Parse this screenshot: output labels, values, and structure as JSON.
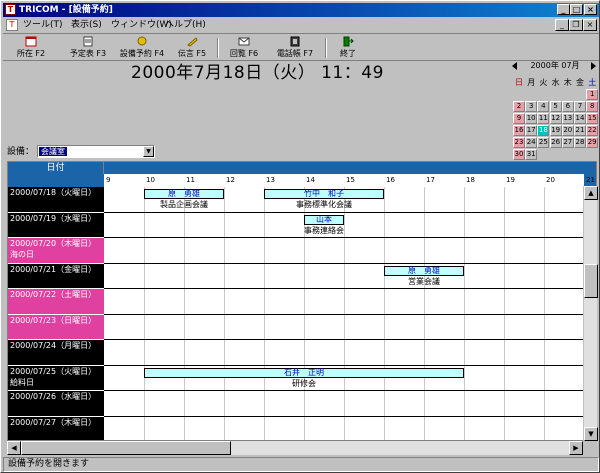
{
  "window": {
    "title": "TRICOM - [設備予約]"
  },
  "menu": [
    {
      "label": "ツール(T)"
    },
    {
      "label": "表示(S)"
    },
    {
      "label": "ウィンドウ(W)"
    },
    {
      "label": "ヘルプ(H)"
    }
  ],
  "toolbar": [
    {
      "label": "所在 F2",
      "icon": "calendar-icon",
      "color": "#c00000"
    },
    {
      "label": "予定表 F3",
      "icon": "schedule-icon",
      "color": "#404040"
    },
    {
      "label": "設備予約 F4",
      "icon": "equipment-icon",
      "color": "#c0a000"
    },
    {
      "label": "伝言 F5",
      "icon": "message-icon",
      "color": "#c0a000"
    },
    {
      "label": "回覧 F6",
      "icon": "circular-icon",
      "color": "#404040"
    },
    {
      "label": "電話帳 F7",
      "icon": "phonebook-icon",
      "color": "#404040"
    },
    {
      "label": "終了",
      "icon": "exit-icon",
      "color": "#008000"
    }
  ],
  "clock": {
    "text": "2000年7月18日（火） 11：49"
  },
  "equipment": {
    "label": "設備：",
    "value": "会議室"
  },
  "calendar": {
    "month_label": "2000年 07月",
    "weekdays": [
      "日",
      "月",
      "火",
      "水",
      "木",
      "金",
      "土"
    ],
    "weekday_colors": [
      "#c00000",
      "#000000",
      "#000000",
      "#000000",
      "#000000",
      "#000000",
      "#0000c0"
    ],
    "weeks": [
      [
        "",
        "",
        "",
        "",
        "",
        "",
        "1"
      ],
      [
        "2",
        "3",
        "4",
        "5",
        "6",
        "7",
        "8"
      ],
      [
        "9",
        "10",
        "11",
        "12",
        "13",
        "14",
        "15"
      ],
      [
        "16",
        "17",
        "18",
        "19",
        "20",
        "21",
        "22"
      ],
      [
        "23",
        "24",
        "25",
        "26",
        "27",
        "28",
        "29"
      ],
      [
        "30",
        "31",
        "",
        "",
        "",
        "",
        ""
      ]
    ],
    "today": "18"
  },
  "schedule": {
    "header_label": "日付",
    "hours": [
      "9",
      "10",
      "11",
      "12",
      "13",
      "14",
      "15",
      "16",
      "17",
      "18",
      "19",
      "20",
      "21"
    ],
    "rows": [
      {
        "date": "2000/07/18（火曜日）",
        "note": "",
        "style": "dark"
      },
      {
        "date": "2000/07/19（水曜日）",
        "note": "",
        "style": "dark"
      },
      {
        "date": "2000/07/20（木曜日）",
        "note": "海の日",
        "style": "pink"
      },
      {
        "date": "2000/07/21（金曜日）",
        "note": "",
        "style": "dark"
      },
      {
        "date": "2000/07/22（土曜日）",
        "note": "",
        "style": "pink"
      },
      {
        "date": "2000/07/23（日曜日）",
        "note": "",
        "style": "pink"
      },
      {
        "date": "2000/07/24（月曜日）",
        "note": "",
        "style": "dark"
      },
      {
        "date": "2000/07/25（火曜日）",
        "note": "給料日",
        "style": "dark"
      },
      {
        "date": "2000/07/26（水曜日）",
        "note": "",
        "style": "dark"
      },
      {
        "date": "2000/07/27（木曜日）",
        "note": "",
        "style": "dark"
      }
    ],
    "events": [
      {
        "row": 0,
        "start": 10,
        "end": 12,
        "person": "原　勇雄",
        "title": "製品企画会議"
      },
      {
        "row": 0,
        "start": 13,
        "end": 16,
        "person": "竹中　和子",
        "title": "事務標準化会議"
      },
      {
        "row": 1,
        "start": 14,
        "end": 15,
        "person": "山本",
        "title": "事務連絡会"
      },
      {
        "row": 3,
        "start": 16,
        "end": 18,
        "person": "原　勇雄",
        "title": "営業会議"
      },
      {
        "row": 7,
        "start": 10,
        "end": 18,
        "person": "石井　正明",
        "title": "研修会"
      }
    ]
  },
  "status": {
    "text": "設備予約を開きます"
  }
}
